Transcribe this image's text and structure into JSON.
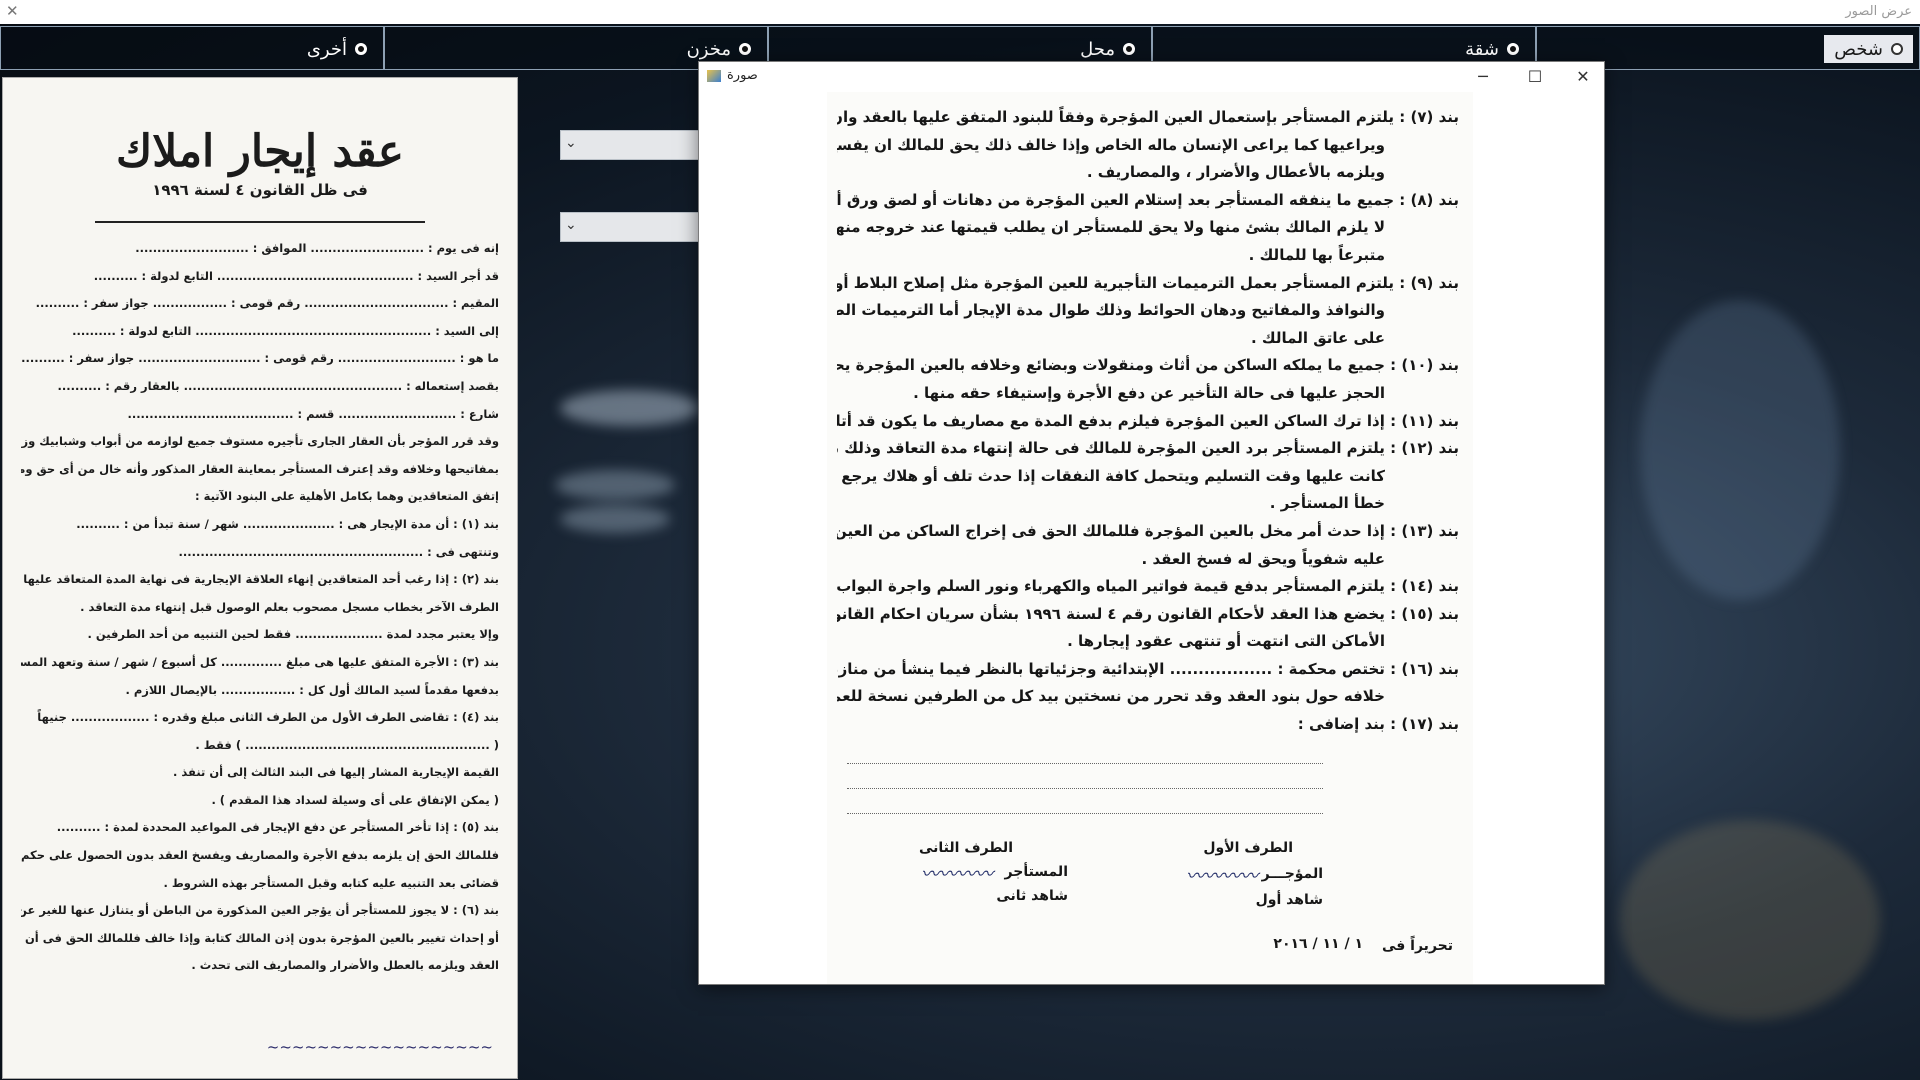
{
  "app": {
    "title": "عرض الصور"
  },
  "radio_options": [
    {
      "label": "شخص",
      "selected": false
    },
    {
      "label": "شقة",
      "selected": true
    },
    {
      "label": "محل",
      "selected": true
    },
    {
      "label": "مخزن",
      "selected": true
    },
    {
      "label": "أخرى",
      "selected": true
    }
  ],
  "left_doc": {
    "title": "عقد إيجار املاك",
    "subtitle": "فى ظل القانون ٤ لسنة ١٩٩٦",
    "lines": [
      "إنه فى يوم : .......................... الموافق : ..........................",
      "قد أجر السيد : ............................................. التابع لدولة : ..........",
      "المقيم : ................................. رقم قومى : ................. جواز سفر : ..........",
      "إلى السيد : ...................................................... التابع لدولة : ..........",
      "ما هو : ........................... رقم قومى : ............................ جواز سفر : ..........",
      "بقصد إستعماله : .................................................. بالعقار رقم : ..........",
      "شارع : ........................... قسم : ......................................",
      "وقد قرر المؤجر بأن العقار الجارى تأجيره مستوف جميع لوازمه من أبواب وشبابيك وزجاج وكوالين",
      "بمفاتيحها وخلافه وقد إعترف المستأجر بمعاينة العقار المذكور وأنه خال من أى حق وموافق لسكنه وقد",
      "إتفق المتعاقدين وهما بكامل الأهلية على البنود الآتية :",
      "بند (١) : أن مدة الإيجار هى : ..................... شهر / سنة تبدأ من : ..........",
      "وتنتهى فى : ........................................................",
      "بند (٢) : إذا رغب أحد المتعاقدين إنهاء العلاقة الإيجارية فى نهاية المدة المتعاقد عليها وجب أن يعلن",
      "الطرف الآخر بخطاب مسجل مصحوب بعلم الوصول قبل إنتهاء مدة التعاقد .",
      "وإلا يعتبر مجدد لمدة .................... فقط لحين التنبيه من أحد الطرفين .",
      "بند (٣) : الأجرة المتفق عليها هى مبلغ .............. كل أسبوع / شهر / سنة وتعهد المستأجر",
      "بدفعها مقدماً لسيد المالك أول كل : ................. بالإيصال اللازم .",
      "بند (٤) : تقاضى الطرف الأول من الطرف الثانى مبلغ وقدره : .................. جنيهاً",
      "( ........................................................ ) فقط .",
      "القيمة الإيجارية المشار إليها فى البند الثالث إلى أن تنفذ .",
      "( يمكن الإتفاق على أى وسيلة لسداد هذا المقدم ) .",
      "بند (٥) : إذا تأخر المستأجر عن دفع الإيجار فى المواعيد المحددة لمدة : ..........",
      "فللمالك الحق إن يلزمه بدفع الأجرة والمصاريف ويفسخ العقد بدون الحصول على حكم",
      "قضائى بعد التنبيه عليه كتابه وقبل المستأجر بهذه الشروط .",
      "بند (٦) : لا يجوز للمستأجر أن يؤجر العين المذكورة من الباطن أو يتنازل عنها للغير عن أى مدة كانت",
      "أو إحداث تغيير بالعين المؤجرة بدون إذن المالك كتابة وإذا خالف فللمالك الحق فى أن يفسخ",
      "العقد ويلزمه بالعطل والأضرار والمصاريف التى تحدث ."
    ]
  },
  "image_window": {
    "title": "صورة",
    "clauses": [
      "بند (٧) : يلتزم المستأجر بإستعمال العين المؤجرة وفقاً للبنود المتفق عليها بالعقد وان يحافظ عليها",
      "ويراعيها كما يراعى الإنسان ماله الخاص وإذا خالف ذلك يحق للمالك ان يفسخ العقد",
      "ويلزمه بالأعطال والأضرار ، والمصاريف .",
      "بند (٨) : جميع ما ينفقه المستأجر بعد إستلام العين المؤجرة من دهانات أو لصق ورق أو ديكور وخلافه",
      "لا يلزم المالك بشئ منها ولا يحق للمستأجر ان يطلب قيمتها عند خروجه منها بل يكون",
      "متبرعاً بها للمالك .",
      "بند (٩) : يلتزم المستأجر بعمل الترميمات التأجيرية للعين المؤجرة مثل إصلاح البلاط أو الأبواب",
      "والنوافذ والمفاتيح ودهان الحوائط وذلك طوال مدة الإيجار أما الترميمات الضرورية تكون",
      "على عاتق المالك .",
      "بند (١٠) : جميع ما يملكه الساكن من أثاث ومنقولات وبضائع وخلافه بالعين المؤجرة يحق للمالك",
      "الحجز عليها فى حالة التأخير عن دفع الأجرة وإستيفاء حقه منها .",
      "بند (١١) : إذا ترك الساكن العين المؤجرة فيلزم بدفع المدة مع مصاريف ما يكون قد أتلف بها .",
      "بند (١٢) : يلتزم المستأجر برد العين المؤجرة للمالك فى حالة إنتهاء مدة التعاقد وذلك بالحالة التى",
      "كانت عليها وقت التسليم ويتحمل كافة النفقات إذا حدث تلف أو هلاك يرجع إلى",
      "خطأ المستأجر .",
      "بند (١٣) : إذا حدث أمر مخل بالعين المؤجرة فللمالك الحق فى إخراج الساكن من العين بمجرد التنبيه",
      "عليه شفوياً ويحق له فسخ العقد .",
      "بند (١٤) : يلتزم المستأجر بدفع قيمة فواتير المياه والكهرباء ونور السلم واجرة البواب والتليفون ، إذا وجد .",
      "بند (١٥) : يخضع هذا العقد لأحكام القانون رقم ٤ لسنة ١٩٩٦ بشأن سريان احكام القانون المدنى على",
      "الأماكن التى انتهت أو تنتهى عقود إيجارها .",
      "بند (١٦) : تختص محكمة : .................. الإبتدائية وجزئياتها بالنظر فيما ينشأ من منازعات او",
      "خلافه حول بنود العقد وقد تحرر من نسختين بيد كل من الطرفين نسخة للعمل بموجبها .",
      "بند (١٧) : بند إضافى :"
    ],
    "party_first": "الطرف الأول",
    "party_second": "الطرف الثانى",
    "lessor": "المؤجـــر",
    "lessee": "المستأجر",
    "witness_first": "شاهد أول",
    "witness_second": "شاهد ثانى",
    "dated": "تحريراً فى",
    "date_value": "١ / ١١ / ٢٠١٦"
  }
}
